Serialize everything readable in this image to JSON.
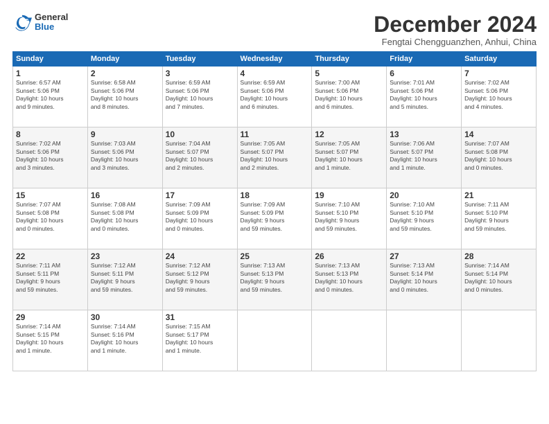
{
  "header": {
    "logo_general": "General",
    "logo_blue": "Blue",
    "month_title": "December 2024",
    "location": "Fengtai Chengguanzhen, Anhui, China"
  },
  "weekdays": [
    "Sunday",
    "Monday",
    "Tuesday",
    "Wednesday",
    "Thursday",
    "Friday",
    "Saturday"
  ],
  "weeks": [
    [
      {
        "day": "1",
        "info": "Sunrise: 6:57 AM\nSunset: 5:06 PM\nDaylight: 10 hours\nand 9 minutes."
      },
      {
        "day": "2",
        "info": "Sunrise: 6:58 AM\nSunset: 5:06 PM\nDaylight: 10 hours\nand 8 minutes."
      },
      {
        "day": "3",
        "info": "Sunrise: 6:59 AM\nSunset: 5:06 PM\nDaylight: 10 hours\nand 7 minutes."
      },
      {
        "day": "4",
        "info": "Sunrise: 6:59 AM\nSunset: 5:06 PM\nDaylight: 10 hours\nand 6 minutes."
      },
      {
        "day": "5",
        "info": "Sunrise: 7:00 AM\nSunset: 5:06 PM\nDaylight: 10 hours\nand 6 minutes."
      },
      {
        "day": "6",
        "info": "Sunrise: 7:01 AM\nSunset: 5:06 PM\nDaylight: 10 hours\nand 5 minutes."
      },
      {
        "day": "7",
        "info": "Sunrise: 7:02 AM\nSunset: 5:06 PM\nDaylight: 10 hours\nand 4 minutes."
      }
    ],
    [
      {
        "day": "8",
        "info": "Sunrise: 7:02 AM\nSunset: 5:06 PM\nDaylight: 10 hours\nand 3 minutes."
      },
      {
        "day": "9",
        "info": "Sunrise: 7:03 AM\nSunset: 5:06 PM\nDaylight: 10 hours\nand 3 minutes."
      },
      {
        "day": "10",
        "info": "Sunrise: 7:04 AM\nSunset: 5:07 PM\nDaylight: 10 hours\nand 2 minutes."
      },
      {
        "day": "11",
        "info": "Sunrise: 7:05 AM\nSunset: 5:07 PM\nDaylight: 10 hours\nand 2 minutes."
      },
      {
        "day": "12",
        "info": "Sunrise: 7:05 AM\nSunset: 5:07 PM\nDaylight: 10 hours\nand 1 minute."
      },
      {
        "day": "13",
        "info": "Sunrise: 7:06 AM\nSunset: 5:07 PM\nDaylight: 10 hours\nand 1 minute."
      },
      {
        "day": "14",
        "info": "Sunrise: 7:07 AM\nSunset: 5:08 PM\nDaylight: 10 hours\nand 0 minutes."
      }
    ],
    [
      {
        "day": "15",
        "info": "Sunrise: 7:07 AM\nSunset: 5:08 PM\nDaylight: 10 hours\nand 0 minutes."
      },
      {
        "day": "16",
        "info": "Sunrise: 7:08 AM\nSunset: 5:08 PM\nDaylight: 10 hours\nand 0 minutes."
      },
      {
        "day": "17",
        "info": "Sunrise: 7:09 AM\nSunset: 5:09 PM\nDaylight: 10 hours\nand 0 minutes."
      },
      {
        "day": "18",
        "info": "Sunrise: 7:09 AM\nSunset: 5:09 PM\nDaylight: 9 hours\nand 59 minutes."
      },
      {
        "day": "19",
        "info": "Sunrise: 7:10 AM\nSunset: 5:10 PM\nDaylight: 9 hours\nand 59 minutes."
      },
      {
        "day": "20",
        "info": "Sunrise: 7:10 AM\nSunset: 5:10 PM\nDaylight: 9 hours\nand 59 minutes."
      },
      {
        "day": "21",
        "info": "Sunrise: 7:11 AM\nSunset: 5:10 PM\nDaylight: 9 hours\nand 59 minutes."
      }
    ],
    [
      {
        "day": "22",
        "info": "Sunrise: 7:11 AM\nSunset: 5:11 PM\nDaylight: 9 hours\nand 59 minutes."
      },
      {
        "day": "23",
        "info": "Sunrise: 7:12 AM\nSunset: 5:11 PM\nDaylight: 9 hours\nand 59 minutes."
      },
      {
        "day": "24",
        "info": "Sunrise: 7:12 AM\nSunset: 5:12 PM\nDaylight: 9 hours\nand 59 minutes."
      },
      {
        "day": "25",
        "info": "Sunrise: 7:13 AM\nSunset: 5:13 PM\nDaylight: 9 hours\nand 59 minutes."
      },
      {
        "day": "26",
        "info": "Sunrise: 7:13 AM\nSunset: 5:13 PM\nDaylight: 10 hours\nand 0 minutes."
      },
      {
        "day": "27",
        "info": "Sunrise: 7:13 AM\nSunset: 5:14 PM\nDaylight: 10 hours\nand 0 minutes."
      },
      {
        "day": "28",
        "info": "Sunrise: 7:14 AM\nSunset: 5:14 PM\nDaylight: 10 hours\nand 0 minutes."
      }
    ],
    [
      {
        "day": "29",
        "info": "Sunrise: 7:14 AM\nSunset: 5:15 PM\nDaylight: 10 hours\nand 1 minute."
      },
      {
        "day": "30",
        "info": "Sunrise: 7:14 AM\nSunset: 5:16 PM\nDaylight: 10 hours\nand 1 minute."
      },
      {
        "day": "31",
        "info": "Sunrise: 7:15 AM\nSunset: 5:17 PM\nDaylight: 10 hours\nand 1 minute."
      },
      null,
      null,
      null,
      null
    ]
  ]
}
